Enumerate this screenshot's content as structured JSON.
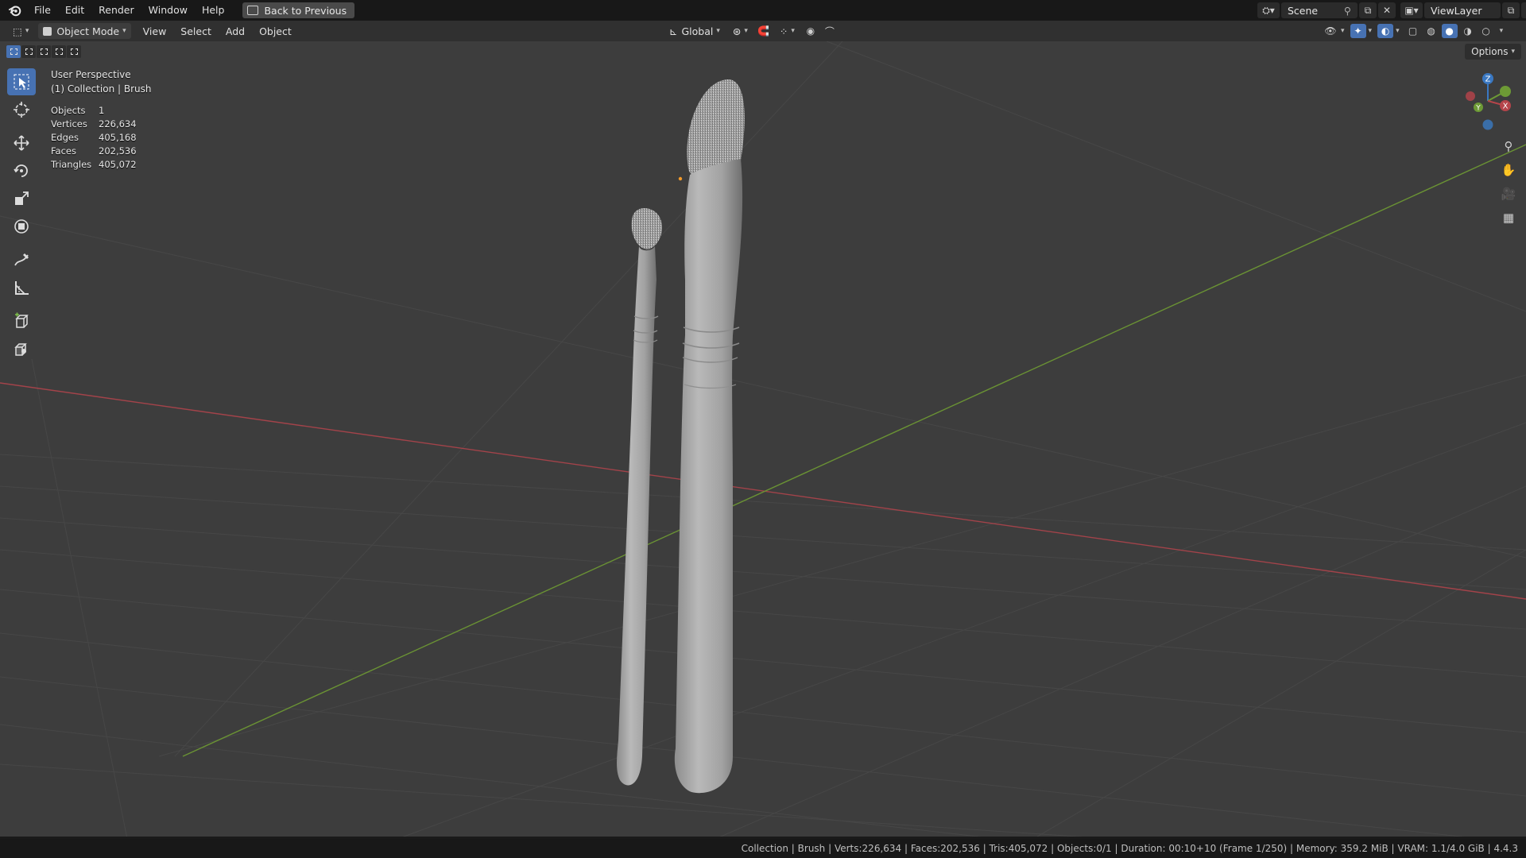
{
  "menubar": {
    "items": [
      "File",
      "Edit",
      "Render",
      "Window",
      "Help"
    ],
    "back_button": "Back to Previous",
    "scene": "Scene",
    "view_layer": "ViewLayer"
  },
  "header": {
    "mode": "Object Mode",
    "menus": [
      "View",
      "Select",
      "Add",
      "Object"
    ],
    "orientation": "Global",
    "options": "Options"
  },
  "viewport": {
    "perspective": "User Perspective",
    "collection": "(1) Collection | Brush",
    "stats": [
      {
        "label": "Objects",
        "value": "1"
      },
      {
        "label": "Vertices",
        "value": "226,634"
      },
      {
        "label": "Edges",
        "value": "405,168"
      },
      {
        "label": "Faces",
        "value": "202,536"
      },
      {
        "label": "Triangles",
        "value": "405,072"
      }
    ],
    "gizmo_axes": {
      "x": "X",
      "y": "Y",
      "z": "Z"
    },
    "colors": {
      "x_axis": "#b5444a",
      "y_axis": "#6d9a35",
      "z_axis": "#3a78c2",
      "accent": "#4772b3"
    }
  },
  "toolbar": {
    "tools": [
      "select-box",
      "cursor",
      "move",
      "rotate",
      "scale",
      "transform",
      "annotate",
      "measure",
      "add-cube",
      "add-object"
    ]
  },
  "statusbar": {
    "text": "Collection | Brush | Verts:226,634 | Faces:202,536 | Tris:405,072 | Objects:0/1 | Duration: 00:10+10 (Frame 1/250) | Memory: 359.2 MiB | VRAM: 1.1/4.0 GiB | 4.4.3"
  }
}
